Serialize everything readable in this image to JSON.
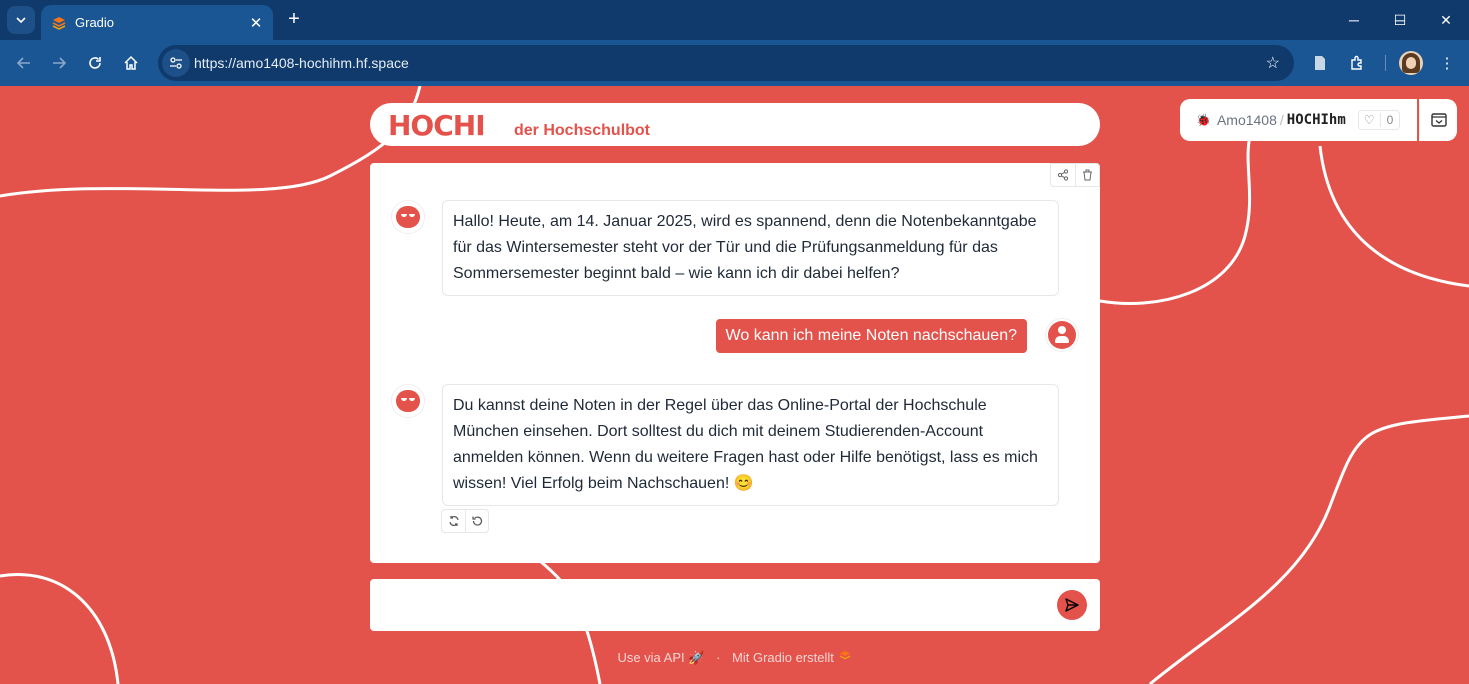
{
  "browser": {
    "tab_title": "Gradio",
    "url": "https://amo1408-hochihm.hf.space",
    "tab_close": "✕",
    "new_tab": "+",
    "minimize": "─",
    "maximize": "☐",
    "close": "✕"
  },
  "header": {
    "logo": "HOCHI",
    "subtitle": "der Hochschulbot"
  },
  "hf_badge": {
    "owner": "Amo1408",
    "space": "HOCHIhm",
    "likes": "0"
  },
  "chat": {
    "messages": [
      {
        "role": "bot",
        "text": "Hallo! Heute, am 14. Januar 2025, wird es spannend, denn die Notenbekanntgabe für das Wintersemester steht vor der Tür und die Prüfungsanmeldung für das Sommersemester beginnt bald – wie kann ich dir dabei helfen?"
      },
      {
        "role": "user",
        "text": "Wo kann ich meine Noten nachschauen?"
      },
      {
        "role": "bot",
        "text": "Du kannst deine Noten in der Regel über das Online-Portal der Hochschule München einsehen. Dort solltest du dich mit deinem Studierenden-Account anmelden können. Wenn du weitere Fragen hast oder Hilfe benötigst, lass es mich wissen! Viel Erfolg beim Nachschauen! 😊"
      }
    ]
  },
  "input": {
    "value": "",
    "placeholder": ""
  },
  "footer": {
    "api_link": "Use via API",
    "gradio_link": "Mit Gradio erstellt",
    "separator": "·"
  },
  "colors": {
    "accent": "#e3524b",
    "chrome_dark": "#0f3a6b",
    "chrome_toolbar": "#1a5694"
  }
}
